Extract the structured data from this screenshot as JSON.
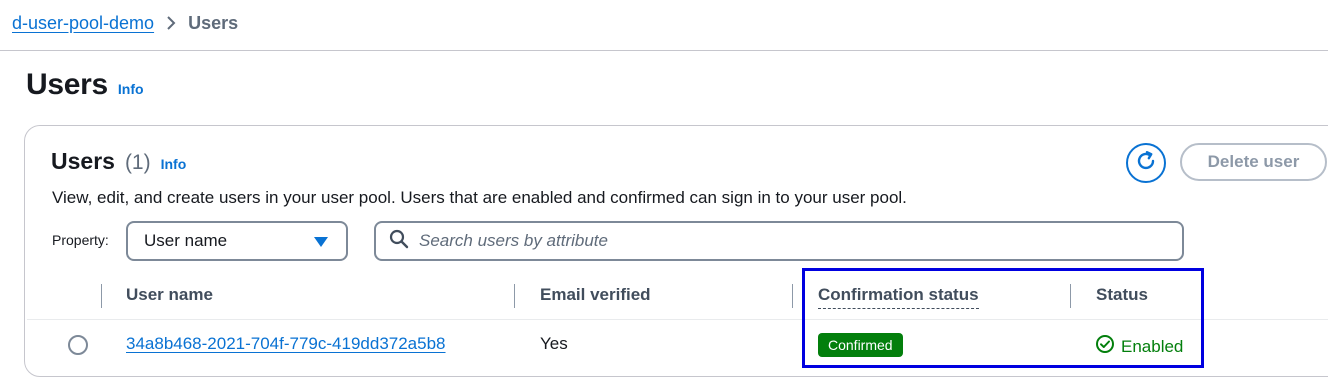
{
  "breadcrumb": {
    "parent": "d-user-pool-demo",
    "current": "Users"
  },
  "page": {
    "title": "Users",
    "info": "Info"
  },
  "panel": {
    "title": "Users",
    "count": "(1)",
    "info": "Info",
    "description": "View, edit, and create users in your user pool. Users that are enabled and confirmed can sign in to your user pool.",
    "delete_label": "Delete user"
  },
  "filter": {
    "property_label": "Property:",
    "property_value": "User name",
    "search_placeholder": "Search users by attribute"
  },
  "table": {
    "headers": [
      "User name",
      "Email verified",
      "Confirmation status",
      "Status"
    ],
    "rows": [
      {
        "user_name": "34a8b468-2021-704f-779c-419dd372a5b8",
        "email_verified": "Yes",
        "confirmation_status": "Confirmed",
        "status": "Enabled"
      }
    ]
  },
  "colors": {
    "link": "#0972d3",
    "success": "#037f0c",
    "highlight": "#0000e0"
  },
  "icons": {
    "breadcrumb_separator": "chevron-right-icon",
    "refresh": "refresh-icon",
    "search": "search-icon",
    "status": "check-circle-icon",
    "dropdown": "caret-down-icon"
  }
}
